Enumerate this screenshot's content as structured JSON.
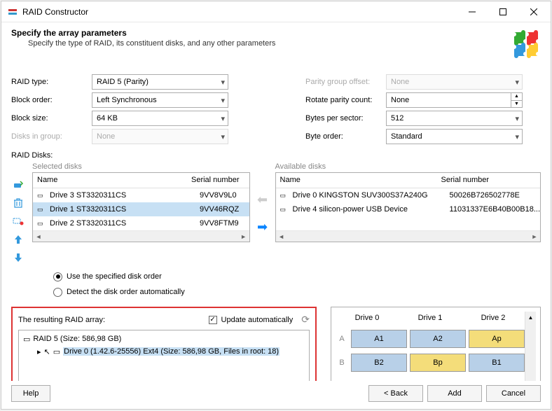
{
  "window": {
    "title": "RAID Constructor"
  },
  "header": {
    "title": "Specify the array parameters",
    "subtitle": "Specify the type of RAID, its constituent disks, and any other parameters"
  },
  "params": {
    "left": {
      "raid_type": {
        "label": "RAID type:",
        "value": "RAID 5 (Parity)"
      },
      "block_order": {
        "label": "Block order:",
        "value": "Left Synchronous"
      },
      "block_size": {
        "label": "Block size:",
        "value": "64 KB"
      },
      "disks_in_group": {
        "label": "Disks in group:",
        "value": "None"
      }
    },
    "right": {
      "parity_offset": {
        "label": "Parity group offset:",
        "value": "None"
      },
      "rotate_count": {
        "label": "Rotate parity count:",
        "value": "None"
      },
      "bytes_per_sector": {
        "label": "Bytes per sector:",
        "value": "512"
      },
      "byte_order": {
        "label": "Byte order:",
        "value": "Standard"
      }
    }
  },
  "raid_disks_label": "RAID Disks:",
  "selected": {
    "title": "Selected disks",
    "headers": {
      "name": "Name",
      "serial": "Serial number"
    },
    "rows": [
      {
        "name": "Drive 3 ST3320311CS",
        "serial": "9VV8V9L0",
        "sel": false
      },
      {
        "name": "Drive 1 ST3320311CS",
        "serial": "9VV46RQZ",
        "sel": true
      },
      {
        "name": "Drive 2 ST3320311CS",
        "serial": "9VV8FTM9",
        "sel": false
      }
    ]
  },
  "available": {
    "title": "Available disks",
    "headers": {
      "name": "Name",
      "serial": "Serial number"
    },
    "rows": [
      {
        "name": "Drive 0 KINGSTON SUV300S37A240G",
        "serial": "50026B726502778E"
      },
      {
        "name": "Drive 4 silicon-power USB Device",
        "serial": "11031337E6B40B00B18..."
      }
    ]
  },
  "radios": {
    "specified": "Use the specified disk order",
    "auto": "Detect the disk order automatically"
  },
  "result": {
    "label": "The resulting RAID array:",
    "update": "Update automatically",
    "raid": "RAID 5 (Size: 586,98 GB)",
    "drive": "Drive 0 (1.42.6-25556) Ext4 (Size: 586,98 GB, Files in root: 18)"
  },
  "layout": {
    "headers": [
      "Drive 0",
      "Drive 1",
      "Drive 2"
    ],
    "rows": [
      {
        "label": "A",
        "cells": [
          {
            "t": "A1",
            "c": "blue"
          },
          {
            "t": "A2",
            "c": "blue"
          },
          {
            "t": "Ap",
            "c": "yellow"
          }
        ]
      },
      {
        "label": "B",
        "cells": [
          {
            "t": "B2",
            "c": "blue"
          },
          {
            "t": "Bp",
            "c": "yellow"
          },
          {
            "t": "B1",
            "c": "blue"
          }
        ]
      }
    ]
  },
  "buttons": {
    "help": "Help",
    "back": "< Back",
    "add": "Add",
    "cancel": "Cancel"
  }
}
